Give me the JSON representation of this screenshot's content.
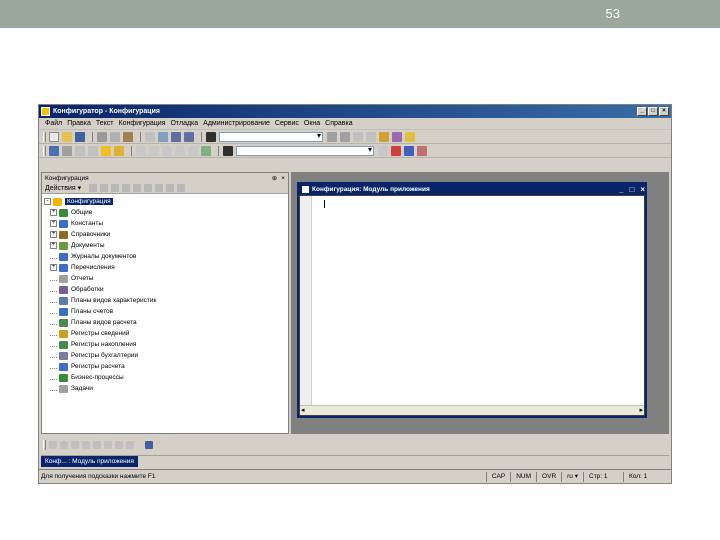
{
  "slide": {
    "number": "53"
  },
  "window": {
    "title": "Конфигуратор - Конфигурация",
    "min": "_",
    "max": "□",
    "close": "×"
  },
  "menu": [
    "Файл",
    "Правка",
    "Текст",
    "Конфигурация",
    "Отладка",
    "Администрирование",
    "Сервис",
    "Окна",
    "Справка"
  ],
  "colors": {
    "header": "#9aa79b",
    "titlebar": "#0a246a",
    "chrome": "#d4d0c8"
  },
  "left_panel": {
    "title": "Конфигурация",
    "pin": "⊕",
    "close": "×",
    "actions_label": "Действия ▾",
    "tree": [
      {
        "label": "Конфигурация",
        "root": true,
        "expander": "-",
        "icon": "#f5b400"
      },
      {
        "label": "Общие",
        "expander": "+",
        "icon": "#3a8a3a"
      },
      {
        "label": "Константы",
        "expander": "+",
        "icon": "#3c6ec8"
      },
      {
        "label": "Справочники",
        "expander": "+",
        "icon": "#8b6b20"
      },
      {
        "label": "Документы",
        "expander": "+",
        "icon": "#6a9a3a"
      },
      {
        "label": "Журналы документов",
        "expander": "",
        "icon": "#3c6ec8"
      },
      {
        "label": "Перечисления",
        "expander": "+",
        "icon": "#3c6ec8"
      },
      {
        "label": "Отчеты",
        "expander": "",
        "icon": "#a0a0a0"
      },
      {
        "label": "Обработки",
        "expander": "",
        "icon": "#7a5a9a"
      },
      {
        "label": "Планы видов характеристик",
        "expander": "",
        "icon": "#5a7ab0"
      },
      {
        "label": "Планы счетов",
        "expander": "",
        "icon": "#3c6ec8"
      },
      {
        "label": "Планы видов расчета",
        "expander": "",
        "icon": "#4a8a4a"
      },
      {
        "label": "Регистры сведений",
        "expander": "",
        "icon": "#c8a020"
      },
      {
        "label": "Регистры накопления",
        "expander": "",
        "icon": "#4a8a4a"
      },
      {
        "label": "Регистры бухгалтерии",
        "expander": "",
        "icon": "#7a7a9a"
      },
      {
        "label": "Регистры расчета",
        "expander": "",
        "icon": "#3c6ec8"
      },
      {
        "label": "Бизнес-процессы",
        "expander": "",
        "icon": "#3a8a3a"
      },
      {
        "label": "Задачи",
        "expander": "",
        "icon": "#a0a0a0"
      }
    ]
  },
  "editor_window": {
    "title": "Конфигурация: Модуль приложения",
    "min": "_",
    "max": "□",
    "close": "×"
  },
  "taskbar": {
    "tab": "Конф... : Модуль приложения"
  },
  "statusbar": {
    "hint": "Для получения подсказки нажмите F1",
    "cap": "CAP",
    "num": "NUM",
    "ovr": "OVR",
    "lang": "ru ▾",
    "line": "Стр: 1",
    "col": "Кол: 1"
  }
}
